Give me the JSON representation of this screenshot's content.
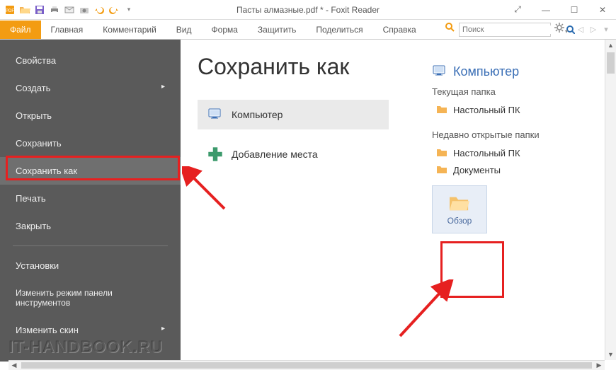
{
  "window": {
    "title": "Пасты алмазные.pdf * - Foxit Reader"
  },
  "qat": {
    "items": [
      "open-icon",
      "save-icon",
      "print-icon",
      "email-icon",
      "snapshot-icon",
      "undo-icon",
      "redo-icon"
    ]
  },
  "ribbon": {
    "tabs": [
      {
        "label": "Файл",
        "active": true
      },
      {
        "label": "Главная"
      },
      {
        "label": "Комментарий"
      },
      {
        "label": "Вид"
      },
      {
        "label": "Форма"
      },
      {
        "label": "Защитить"
      },
      {
        "label": "Поделиться"
      },
      {
        "label": "Справка"
      }
    ],
    "search_placeholder": "Поиск"
  },
  "sidebar": {
    "items": [
      {
        "label": "Свойства"
      },
      {
        "label": "Создать"
      },
      {
        "label": "Открыть"
      },
      {
        "label": "Сохранить"
      },
      {
        "label": "Сохранить как",
        "selected": true
      },
      {
        "label": "Печать"
      },
      {
        "label": "Закрыть"
      }
    ],
    "items2": [
      {
        "label": "Установки"
      },
      {
        "label": "Изменить режим панели инструментов"
      },
      {
        "label": "Изменить скин"
      }
    ]
  },
  "content": {
    "title": "Сохранить как",
    "locations": [
      {
        "label": "Компьютер",
        "active": true,
        "icon": "computer-icon"
      },
      {
        "label": "Добавление места",
        "icon": "plus-icon"
      }
    ]
  },
  "right": {
    "title": "Компьютер",
    "current_label": "Текущая папка",
    "current_folder": "Настольный ПК",
    "recent_label": "Недавно открытые папки",
    "recent": [
      "Настольный ПК",
      "Документы"
    ],
    "browse": "Обзор"
  },
  "watermark": "IT-HANDBOOK.RU"
}
